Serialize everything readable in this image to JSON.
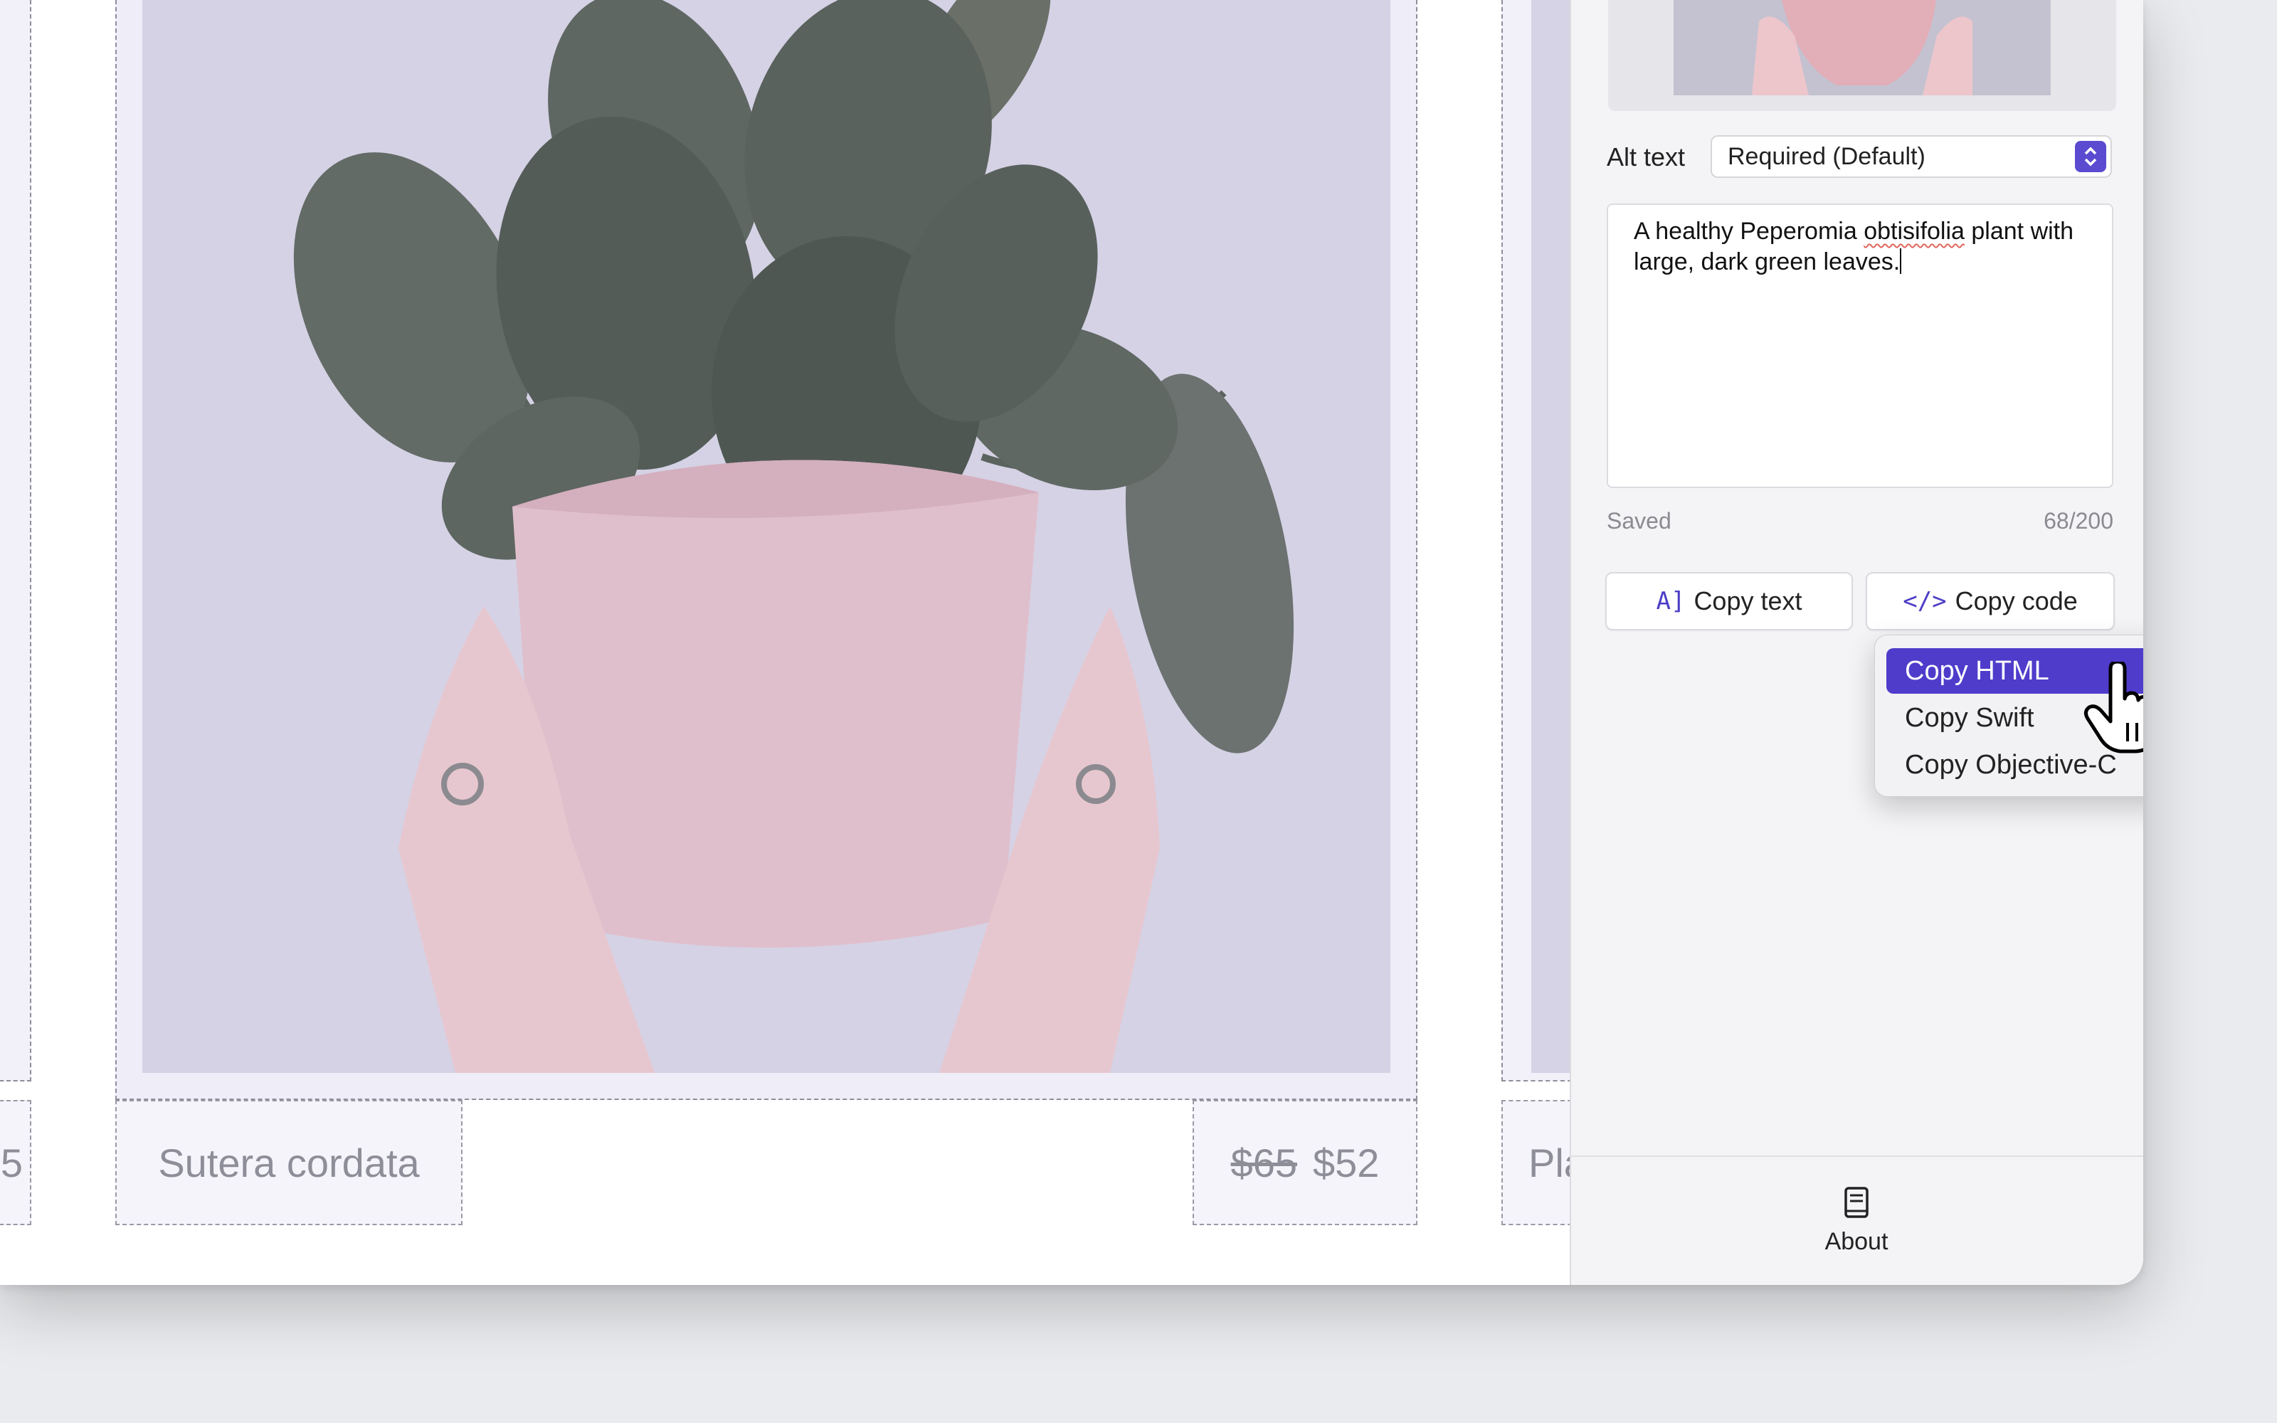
{
  "canvas": {
    "product_name": "Sutera cordata",
    "price_old": "$65",
    "price_new": "$52",
    "left_partial_label": "5",
    "right_partial_label": "Pla"
  },
  "sidebar": {
    "alt_text_label": "Alt text",
    "alt_text_select": "Required (Default)",
    "description": {
      "part1": "A healthy Peperomia ",
      "misspelled": "obtisifolia",
      "part2": " plant with large, dark green leaves."
    },
    "status": "Saved",
    "char_count": "68/200",
    "copy_text_button": "Copy text",
    "copy_text_icon_glyph": "A]",
    "copy_code_button": "Copy code",
    "copy_code_icon_glyph": "</>",
    "about_label": "About"
  },
  "dropdown_menu": {
    "items": [
      "Copy HTML",
      "Copy Swift",
      "Copy Objective-C"
    ],
    "selected": "Copy HTML"
  },
  "colors": {
    "accent": "#4f3ccb",
    "image_tint": "#d6d3e6",
    "pot": "#e1bfcc",
    "leaves": "#5c6560"
  }
}
